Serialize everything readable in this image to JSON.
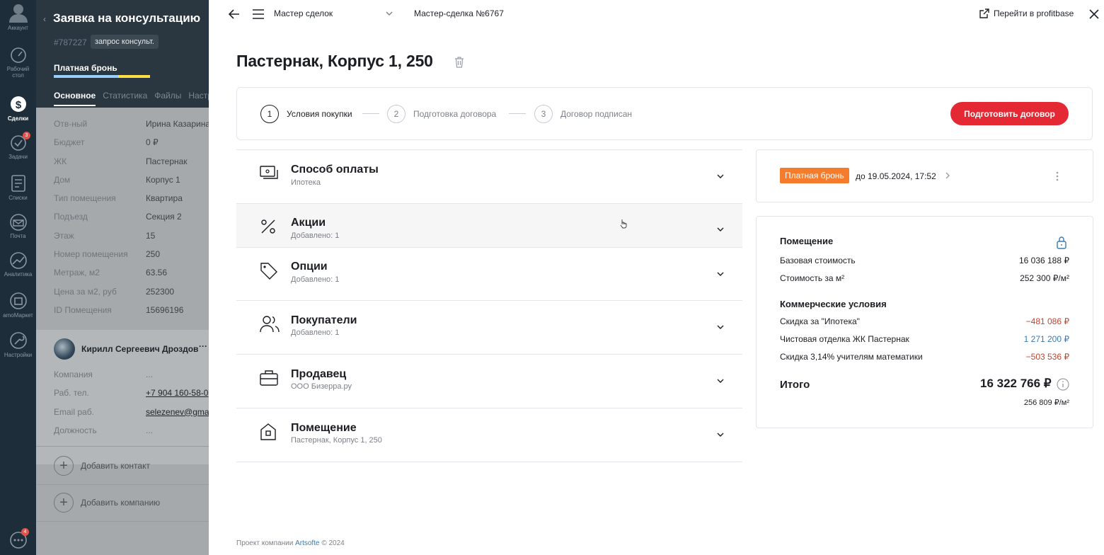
{
  "nav": {
    "account": "Аккаунт",
    "desktop": "Рабочий стол",
    "deals": "Сделки",
    "tasks": "Задачи",
    "tasks_badge": "3",
    "lists": "Списки",
    "mail": "Почта",
    "analytics": "Аналитика",
    "market": "amoМаркет",
    "settings": "Настройки",
    "chat_badge": "4"
  },
  "lead": {
    "title": "Заявка на консультацию",
    "id": "#787227",
    "tag": "запрос консульт.",
    "status": "Платная бронь",
    "status_bar_colors": [
      "#99ccff",
      "#99ccff",
      "#ffdd44"
    ],
    "tabs": [
      "Основное",
      "Статистика",
      "Файлы",
      "Настр"
    ],
    "fields": [
      {
        "label": "Отв-ный",
        "value": "Ирина Казарина"
      },
      {
        "label": "Бюджет",
        "value": "0 ₽"
      },
      {
        "label": "ЖК",
        "value": "Пастернак"
      },
      {
        "label": "Дом",
        "value": "Корпус 1"
      },
      {
        "label": "Тип помещения",
        "value": "Квартира"
      },
      {
        "label": "Подъезд",
        "value": "Секция 2"
      },
      {
        "label": "Этаж",
        "value": "15"
      },
      {
        "label": "Номер помещения",
        "value": "250"
      },
      {
        "label": "Метраж, м2",
        "value": "63.56"
      },
      {
        "label": "Цена за м2, руб",
        "value": "252300"
      },
      {
        "label": "ID Помещения",
        "value": "15696196"
      }
    ],
    "contact": {
      "name": "Кирилл Сергеевич Дроздов",
      "more": "···",
      "fields": [
        {
          "label": "Компания",
          "value": "..."
        },
        {
          "label": "Раб. тел.",
          "value": "+7 904 160-58-0"
        },
        {
          "label": "Email раб.",
          "value": "selezenev@gma"
        },
        {
          "label": "Должность",
          "value": "..."
        }
      ]
    },
    "add_contact": "Добавить контакт",
    "add_company": "Добавить компанию"
  },
  "topbar": {
    "select": "Мастер сделок",
    "deal": "Мастер-сделка №6767",
    "link": "Перейти в profitbase"
  },
  "page_title": "Пастернак, Корпус 1, 250",
  "steps": [
    {
      "num": "1",
      "label": "Условия покупки"
    },
    {
      "num": "2",
      "label": "Подготовка договора"
    },
    {
      "num": "3",
      "label": "Договор подписан"
    }
  ],
  "cta": "Подготовить договор",
  "sections": [
    {
      "title": "Способ оплаты",
      "sub": "Ипотека",
      "icon": "payment-icon"
    },
    {
      "title": "Акции",
      "sub": "Добавлено: 1",
      "icon": "percent-icon"
    },
    {
      "title": "Опции",
      "sub": "Добавлено: 1",
      "icon": "tag-icon"
    },
    {
      "title": "Покупатели",
      "sub": "Добавлено: 1",
      "icon": "users-icon"
    },
    {
      "title": "Продавец",
      "sub": "ООО Бизерра.ру",
      "icon": "briefcase-icon"
    },
    {
      "title": "Помещение",
      "sub": "Пастернак, Корпус 1, 250",
      "icon": "home-icon"
    }
  ],
  "booking": {
    "badge": "Платная бронь",
    "until": "до 19.05.2024, 17:52"
  },
  "summary": {
    "premises_title": "Помещение",
    "base_label": "Базовая стоимость",
    "base_value": "16 036 188 ₽",
    "sqm_label": "Стоимость за м²",
    "sqm_value": "252 300 ₽/м²",
    "commercial_title": "Коммерческие условия",
    "items": [
      {
        "label": "Скидка за \"Ипотека\"",
        "value": "−481 086 ₽",
        "kind": "neg"
      },
      {
        "label": "Чистовая отделка ЖК Пастернак",
        "value": "1 271 200 ₽",
        "kind": "pos"
      },
      {
        "label": "Скидка 3,14% учителям математики",
        "value": "−503 536 ₽",
        "kind": "neg"
      }
    ],
    "total_label": "Итого",
    "total_value": "16 322 766 ₽",
    "total_per_sqm": "256 809 ₽/м²"
  },
  "footer": {
    "prefix": "Проект компании",
    "company": "Artsofte",
    "suffix": "© 2024"
  },
  "colors": {
    "accent_red": "#e52934",
    "badge_orange": "#f47c2c",
    "nav_bg": "#1d2d3a"
  }
}
